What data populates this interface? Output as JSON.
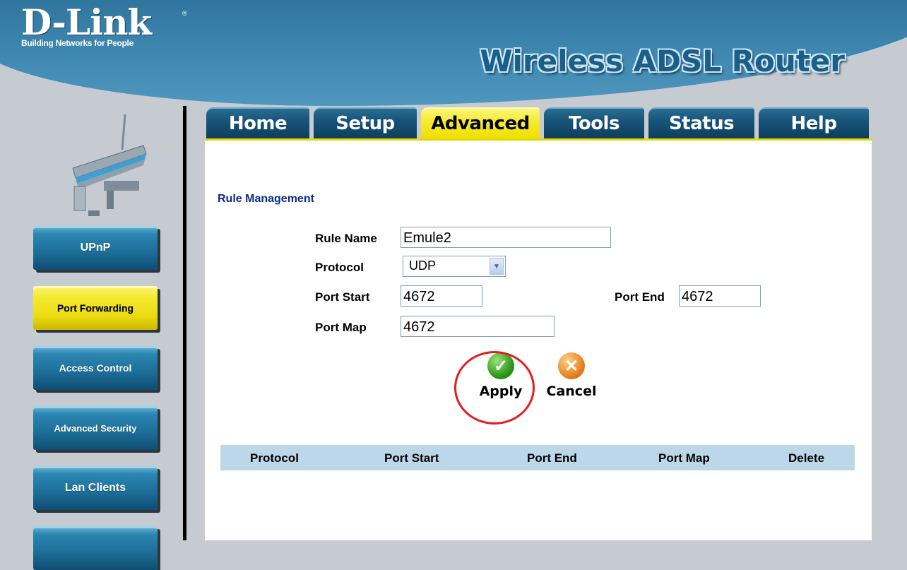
{
  "header": {
    "brand": "D-Link",
    "brand_mark": "®",
    "tagline": "Building Networks for People",
    "product": "Wireless ADSL Router"
  },
  "tabs": [
    {
      "label": "Home"
    },
    {
      "label": "Setup"
    },
    {
      "label": "Advanced"
    },
    {
      "label": "Tools"
    },
    {
      "label": "Status"
    },
    {
      "label": "Help"
    }
  ],
  "active_tab": "Advanced",
  "sidebar": {
    "items": [
      {
        "label": "UPnP"
      },
      {
        "label": "Port Forwarding"
      },
      {
        "label": "Access Control"
      },
      {
        "label": "Advanced Security"
      },
      {
        "label": "Lan Clients"
      }
    ],
    "active_item": "Port Forwarding"
  },
  "form": {
    "section_title": "Rule Management",
    "rule_name_label": "Rule Name",
    "rule_name_value": "Emule2",
    "protocol_label": "Protocol",
    "protocol_value": "UDP",
    "port_start_label": "Port Start",
    "port_start_value": "4672",
    "port_end_label": "Port End",
    "port_end_value": "4672",
    "port_map_label": "Port Map",
    "port_map_value": "4672"
  },
  "actions": {
    "apply": "Apply",
    "cancel": "Cancel"
  },
  "table": {
    "headers": [
      "Protocol",
      "Port Start",
      "Port End",
      "Port Map",
      "Delete"
    ]
  },
  "colors": {
    "accent_blue": "#1a5f8a",
    "active_yellow": "#f5ea30",
    "table_header": "#bcd8e8",
    "highlight_red": "#e51c1c"
  }
}
